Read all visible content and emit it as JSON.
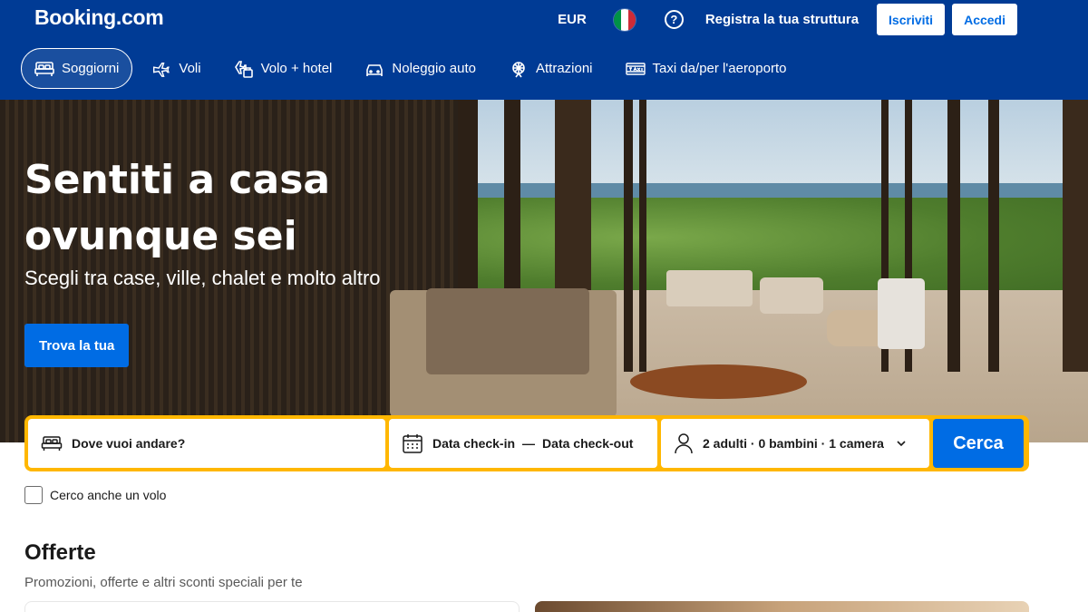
{
  "header": {
    "logo": "Booking.com",
    "currency": "EUR",
    "flag_colors": [
      "#009246",
      "#ffffff",
      "#ce2b37"
    ],
    "help_glyph": "?",
    "register_label": "Registra la tua struttura",
    "signup_label": "Iscriviti",
    "login_label": "Accedi"
  },
  "nav": {
    "items": [
      {
        "label": "Soggiorni",
        "icon": "bed-icon",
        "active": true
      },
      {
        "label": "Voli",
        "icon": "plane-icon"
      },
      {
        "label": "Volo + hotel",
        "icon": "flight-hotel-icon"
      },
      {
        "label": "Noleggio auto",
        "icon": "car-icon"
      },
      {
        "label": "Attrazioni",
        "icon": "attractions-icon"
      },
      {
        "label": "Taxi da/per l'aeroporto",
        "icon": "taxi-icon"
      }
    ]
  },
  "hero": {
    "title": "Sentiti a casa ovunque sei",
    "subtitle": "Scegli tra case, ville, chalet e molto altro",
    "cta_label": "Trova la tua"
  },
  "search": {
    "destination_placeholder": "Dove vuoi andare?",
    "checkin_label": "Data check-in",
    "dash": "—",
    "checkout_label": "Data check-out",
    "guests_label": "2 adulti · 0 bambini · 1 camera",
    "search_label": "Cerca",
    "flight_checkbox_label": "Cerco anche un volo",
    "accent_color": "#ffb700"
  },
  "offers": {
    "title": "Offerte",
    "subtitle": "Promozioni, offerte e altri sconti speciali per te"
  },
  "colors": {
    "brand_blue": "#003b95",
    "button_blue": "#006ce4"
  }
}
